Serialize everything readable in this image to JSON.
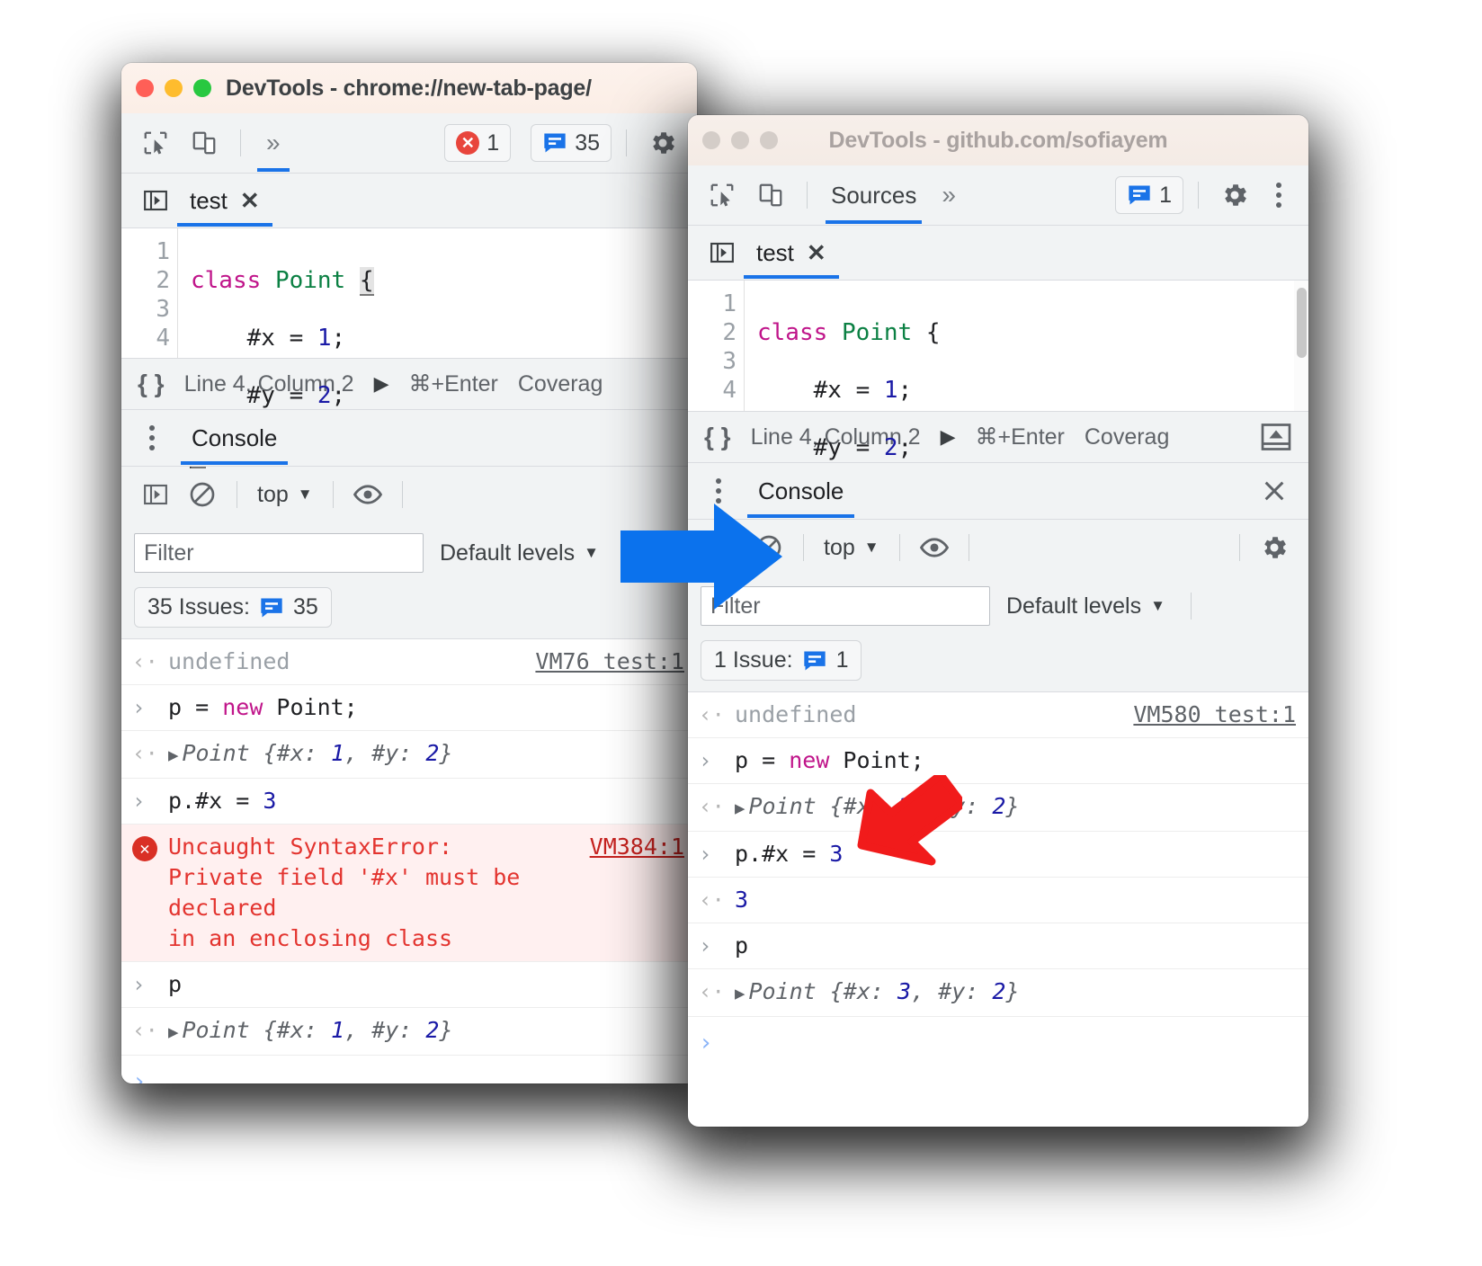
{
  "left_window": {
    "title": "DevTools - chrome://new-tab-page/",
    "active": true,
    "traffic_lights": [
      "close-red",
      "minimize-yellow",
      "zoom-green"
    ],
    "toolbar": {
      "inspect_icon": "inspect-element-icon",
      "device_icon": "device-toolbar-icon",
      "more_panels": "»",
      "error_count": "1",
      "issues_count": "35",
      "settings_icon": "gear-icon"
    },
    "file_tabs": {
      "navigator_icon": "show-navigator-icon",
      "tabs": [
        {
          "label": "test",
          "close": "✕",
          "selected": true
        }
      ]
    },
    "editor": {
      "lines": [
        {
          "n": "1",
          "tokens": [
            {
              "t": "class",
              "c": "kw"
            },
            {
              "t": " ",
              "c": "pln"
            },
            {
              "t": "Point",
              "c": "cls"
            },
            {
              "t": " ",
              "c": "pln"
            },
            {
              "t": "{",
              "c": "hl"
            }
          ]
        },
        {
          "n": "2",
          "tokens": [
            {
              "t": "    #x = ",
              "c": "pln"
            },
            {
              "t": "1",
              "c": "num"
            },
            {
              "t": ";",
              "c": "pln"
            }
          ]
        },
        {
          "n": "3",
          "tokens": [
            {
              "t": "    #y = ",
              "c": "pln"
            },
            {
              "t": "2",
              "c": "num"
            },
            {
              "t": ";",
              "c": "pln"
            }
          ]
        },
        {
          "n": "4",
          "tokens": [
            {
              "t": "}",
              "c": "hl"
            }
          ]
        }
      ]
    },
    "status": {
      "format_icon": "{ }",
      "cursor": "Line 4, Column 2",
      "run_icon": "▶",
      "run_shortcut": "⌘+Enter",
      "coverage": "Coverag"
    },
    "drawer": {
      "kebab_icon": "more-options-icon",
      "tab": "Console"
    },
    "console_toolbar": {
      "sidebar_icon": "console-sidebar-icon",
      "clear_icon": "clear-console-icon",
      "context": "top",
      "eye_icon": "live-expression-icon"
    },
    "filter_row": {
      "filter_placeholder": "Filter",
      "levels": "Default levels"
    },
    "issues_row": {
      "label": "35 Issues:",
      "count": "35"
    },
    "messages": [
      {
        "kind": "output",
        "gutter": "‹·",
        "parts": [
          {
            "t": "undefined",
            "c": "undef"
          }
        ],
        "source": "VM76 test:1"
      },
      {
        "kind": "input",
        "gutter": "›",
        "parts": [
          {
            "t": "p = ",
            "c": "plain"
          },
          {
            "t": "new",
            "c": "kw"
          },
          {
            "t": " Point;",
            "c": "plain"
          }
        ]
      },
      {
        "kind": "output",
        "gutter": "‹·",
        "disclosure": "▶",
        "parts": [
          {
            "t": "Point {#x: ",
            "c": "obj"
          },
          {
            "t": "1",
            "c": "num"
          },
          {
            "t": ", #y: ",
            "c": "obj"
          },
          {
            "t": "2",
            "c": "num"
          },
          {
            "t": "}",
            "c": "obj"
          }
        ]
      },
      {
        "kind": "input",
        "gutter": "›",
        "parts": [
          {
            "t": "p.#x = ",
            "c": "plain"
          },
          {
            "t": "3",
            "c": "num"
          }
        ]
      },
      {
        "kind": "error",
        "gutter": "error-icon",
        "text": "Uncaught SyntaxError:\nPrivate field '#x' must be declared\nin an enclosing class",
        "source": "VM384:1"
      },
      {
        "kind": "input",
        "gutter": "›",
        "parts": [
          {
            "t": "p",
            "c": "plain"
          }
        ]
      },
      {
        "kind": "output",
        "gutter": "‹·",
        "disclosure": "▶",
        "parts": [
          {
            "t": "Point {#x: ",
            "c": "obj"
          },
          {
            "t": "1",
            "c": "num"
          },
          {
            "t": ", #y: ",
            "c": "obj"
          },
          {
            "t": "2",
            "c": "num"
          },
          {
            "t": "}",
            "c": "obj"
          }
        ]
      }
    ],
    "prompt": "›"
  },
  "right_window": {
    "title": "DevTools - github.com/sofiayem",
    "active": false,
    "traffic_lights": [
      "close-gray",
      "minimize-gray",
      "zoom-gray"
    ],
    "toolbar": {
      "inspect_icon": "inspect-element-icon",
      "device_icon": "device-toolbar-icon",
      "panel": "Sources",
      "more_panels": "»",
      "issues_count": "1",
      "settings_icon": "gear-icon",
      "kebab_icon": "more-tools-icon"
    },
    "file_tabs": {
      "navigator_icon": "show-navigator-icon",
      "tabs": [
        {
          "label": "test",
          "close": "✕",
          "selected": true
        }
      ]
    },
    "editor": {
      "lines": [
        {
          "n": "1",
          "tokens": [
            {
              "t": "class",
              "c": "kw"
            },
            {
              "t": " ",
              "c": "pln"
            },
            {
              "t": "Point",
              "c": "cls"
            },
            {
              "t": " {",
              "c": "pln"
            }
          ]
        },
        {
          "n": "2",
          "tokens": [
            {
              "t": "    #x = ",
              "c": "pln"
            },
            {
              "t": "1",
              "c": "num"
            },
            {
              "t": ";",
              "c": "pln"
            }
          ]
        },
        {
          "n": "3",
          "tokens": [
            {
              "t": "    #y = ",
              "c": "pln"
            },
            {
              "t": "2",
              "c": "num"
            },
            {
              "t": ";",
              "c": "pln"
            }
          ]
        },
        {
          "n": "4",
          "tokens": [
            {
              "t": "}",
              "c": "pln"
            }
          ]
        }
      ]
    },
    "status": {
      "format_icon": "{ }",
      "cursor": "Line 4, Column 2",
      "run_icon": "▶",
      "run_shortcut": "⌘+Enter",
      "coverage": "Coverag",
      "collapse_icon": "collapse-drawer-icon"
    },
    "drawer": {
      "kebab_icon": "more-options-icon",
      "tab": "Console",
      "close_icon": "close-drawer-icon"
    },
    "console_toolbar": {
      "sidebar_icon": "console-sidebar-icon",
      "clear_icon": "clear-console-icon",
      "context": "top",
      "eye_icon": "live-expression-icon",
      "settings_icon": "gear-icon"
    },
    "filter_row": {
      "filter_placeholder": "Filter",
      "levels": "Default levels"
    },
    "issues_row": {
      "label": "1 Issue:",
      "count": "1"
    },
    "messages": [
      {
        "kind": "output",
        "gutter": "‹·",
        "parts": [
          {
            "t": "undefined",
            "c": "undef"
          }
        ],
        "source": "VM580 test:1"
      },
      {
        "kind": "input",
        "gutter": "›",
        "parts": [
          {
            "t": "p = ",
            "c": "plain"
          },
          {
            "t": "new",
            "c": "kw"
          },
          {
            "t": " Point;",
            "c": "plain"
          }
        ]
      },
      {
        "kind": "output",
        "gutter": "‹·",
        "disclosure": "▶",
        "parts": [
          {
            "t": "Point {#x: ",
            "c": "obj"
          },
          {
            "t": "1",
            "c": "num"
          },
          {
            "t": ", #y: ",
            "c": "obj"
          },
          {
            "t": "2",
            "c": "num"
          },
          {
            "t": "}",
            "c": "obj"
          }
        ]
      },
      {
        "kind": "input",
        "gutter": "›",
        "parts": [
          {
            "t": "p.#x = ",
            "c": "plain"
          },
          {
            "t": "3",
            "c": "num"
          }
        ]
      },
      {
        "kind": "output",
        "gutter": "‹·",
        "parts": [
          {
            "t": "3",
            "c": "num"
          }
        ]
      },
      {
        "kind": "input",
        "gutter": "›",
        "parts": [
          {
            "t": "p",
            "c": "plain"
          }
        ]
      },
      {
        "kind": "output",
        "gutter": "‹·",
        "disclosure": "▶",
        "parts": [
          {
            "t": "Point {#x: ",
            "c": "obj"
          },
          {
            "t": "3",
            "c": "num"
          },
          {
            "t": ", #y: ",
            "c": "obj"
          },
          {
            "t": "2",
            "c": "num"
          },
          {
            "t": "}",
            "c": "obj"
          }
        ]
      }
    ],
    "prompt": "›"
  },
  "annotations": {
    "blue_arrow": {
      "name": "transition-arrow",
      "color": "#0b72ed"
    },
    "red_arrow": {
      "name": "highlight-arrow",
      "color": "#f11b1b"
    }
  },
  "colors": {
    "accent_blue": "#1a73e8",
    "arrow_blue": "#0b72ed",
    "arrow_red": "#f11b1b",
    "error_red": "#e3342f",
    "keyword_magenta": "#c0158a",
    "class_green": "#0b8043",
    "number_blue": "#1a1aa6",
    "toolbar_bg": "#f1f3f4",
    "titlebar_active": "#fbeee6",
    "error_bg": "#fff0f0"
  }
}
